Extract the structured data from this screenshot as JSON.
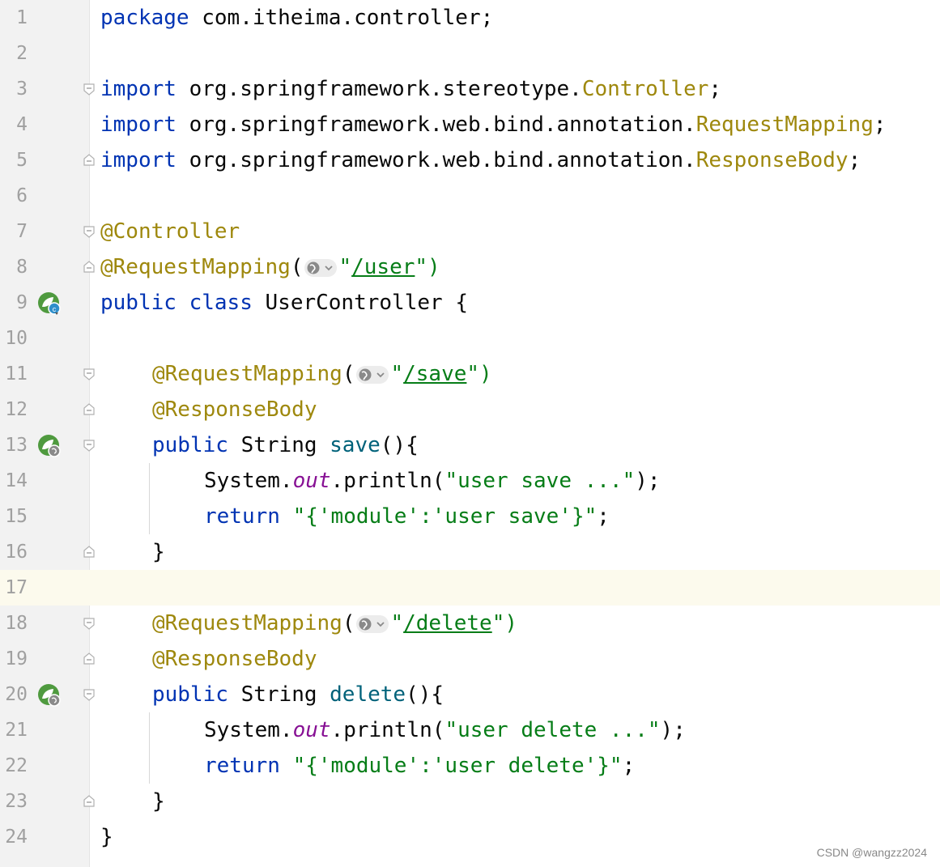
{
  "editor": {
    "lines": [
      {
        "n": "1",
        "t": "package com.itheima.controller;"
      },
      {
        "n": "2",
        "t": ""
      },
      {
        "n": "3",
        "t": "import org.springframework.stereotype.Controller;"
      },
      {
        "n": "4",
        "t": "import org.springframework.web.bind.annotation.RequestMapping;"
      },
      {
        "n": "5",
        "t": "import org.springframework.web.bind.annotation.ResponseBody;"
      },
      {
        "n": "6",
        "t": ""
      },
      {
        "n": "7",
        "t": "@Controller"
      },
      {
        "n": "8",
        "t": "@RequestMapping(\"/user\")"
      },
      {
        "n": "9",
        "t": "public class UserController {"
      },
      {
        "n": "10",
        "t": ""
      },
      {
        "n": "11",
        "t": "@RequestMapping(\"/save\")"
      },
      {
        "n": "12",
        "t": "@ResponseBody"
      },
      {
        "n": "13",
        "t": "public String save(){"
      },
      {
        "n": "14",
        "t": "System.out.println(\"user save ...\");"
      },
      {
        "n": "15",
        "t": "return \"{'module':'user save'}\";"
      },
      {
        "n": "16",
        "t": "}"
      },
      {
        "n": "17",
        "t": ""
      },
      {
        "n": "18",
        "t": "@RequestMapping(\"/delete\")"
      },
      {
        "n": "19",
        "t": "@ResponseBody"
      },
      {
        "n": "20",
        "t": "public String delete(){"
      },
      {
        "n": "21",
        "t": "System.out.println(\"user delete ...\");"
      },
      {
        "n": "22",
        "t": "return \"{'module':'user delete'}\";"
      },
      {
        "n": "23",
        "t": "}"
      },
      {
        "n": "24",
        "t": "}"
      }
    ],
    "current_line": "17",
    "gutter_icons": {
      "9": "spring-bean-class-icon",
      "13": "spring-web-endpoint-icon",
      "20": "spring-web-endpoint-icon"
    }
  },
  "tokens": {
    "kw_package": "package",
    "pkg_name": "com.itheima.controller;",
    "kw_import": "import",
    "import1_path": "org.springframework.stereotype.",
    "import1_cls": "Controller",
    "import2_path": "org.springframework.web.bind.annotation.",
    "import2_cls": "RequestMapping",
    "import3_path": "org.springframework.web.bind.annotation.",
    "import3_cls": "ResponseBody",
    "semicolon": ";",
    "ann_controller": "@Controller",
    "ann_request_mapping": "@RequestMapping",
    "ann_response_body": "@ResponseBody",
    "open_paren": "(",
    "quote": "\"",
    "close_paren_quote": "\")",
    "url_user": "/user",
    "url_save": "/save",
    "url_delete": "/delete",
    "kw_public": "public",
    "kw_class": "class",
    "class_name": "UserController {",
    "type_string": "String",
    "fn_save": "save",
    "fn_delete": "delete",
    "paren_brace": "(){",
    "system": "System.",
    "out": "out",
    "println": ".println(",
    "str_save": "\"user save ...\"",
    "str_delete": "\"user delete ...\"",
    "close_stmt": ");",
    "kw_return": "return",
    "ret_save": "\"{'module':'user save'}\"",
    "ret_delete": "\"{'module':'user delete'}\"",
    "close_brace": "}"
  },
  "watermark": "CSDN @wangzz2024",
  "colors": {
    "keyword": "#0033b3",
    "annotation": "#9e880d",
    "string": "#067d17",
    "method": "#00627a",
    "field": "#871094",
    "line_number": "#a0a0a0",
    "current_line_bg": "#fcfaed",
    "gutter_bg": "#f2f2f2"
  }
}
